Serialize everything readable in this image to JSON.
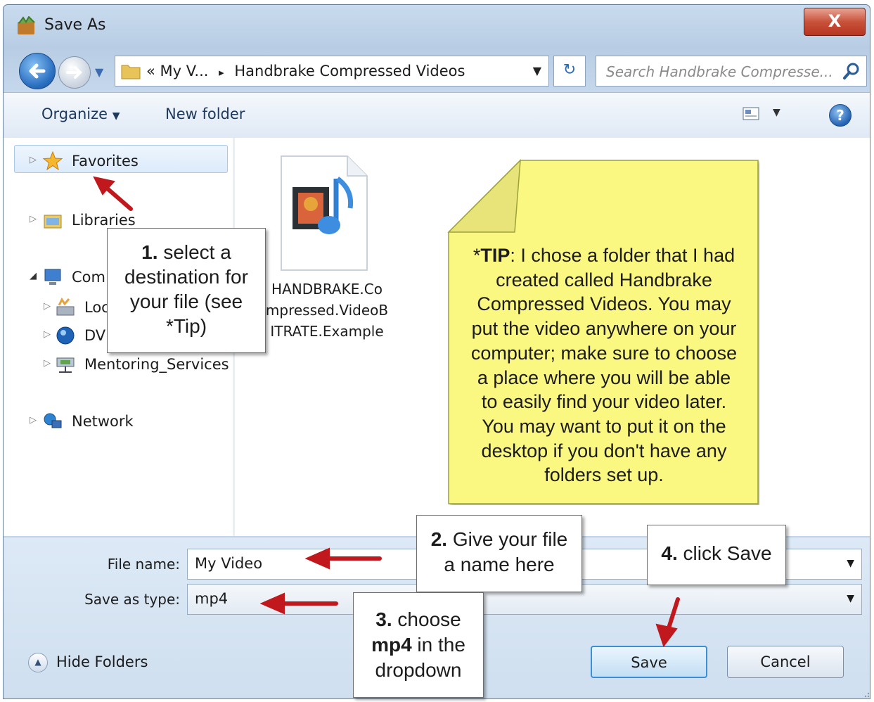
{
  "window": {
    "title": "Save As",
    "close_label": "X"
  },
  "nav": {
    "address_prefix": "«",
    "address_parts": [
      "My V...",
      "Handbrake Compressed Videos"
    ],
    "address_separator": "▸",
    "search_placeholder": "Search Handbrake Compresse..."
  },
  "toolbar": {
    "organize": "Organize",
    "new_folder": "New folder",
    "help": "?"
  },
  "sidebar": {
    "items": [
      {
        "label": "Favorites",
        "icon": "star-icon"
      },
      {
        "label": "Libraries",
        "icon": "libraries-icon"
      },
      {
        "label": "Com",
        "icon": "computer-icon"
      },
      {
        "label": "Loc",
        "icon": "local-disk-icon"
      },
      {
        "label": "DV",
        "icon": "dvd-drive-icon"
      },
      {
        "label": "Mentoring_Services",
        "icon": "network-drive-icon"
      },
      {
        "label": "Network",
        "icon": "network-icon"
      }
    ]
  },
  "file": {
    "name_lines": [
      "HANDBRAKE.Co",
      "mpressed.VideoB",
      "ITRATE.Example"
    ],
    "icon": "video-file-icon"
  },
  "form": {
    "file_name_label": "File name:",
    "file_name_value": "My Video",
    "save_type_label": "Save as type:",
    "save_type_value": "mp4"
  },
  "footer": {
    "hide_folders": "Hide Folders",
    "save": "Save",
    "cancel": "Cancel"
  },
  "callouts": {
    "c1": {
      "num": "1.",
      "line1": "select a",
      "line2": "destination for",
      "line3": "your file (see",
      "line4": "*Tip)"
    },
    "c2": {
      "num": "2.",
      "line1": "Give your file",
      "line2": "a name here"
    },
    "c3": {
      "num": "3.",
      "line1a": "choose",
      "bold": "mp4",
      "line2b": "in the",
      "line3": "dropdown"
    },
    "c4": {
      "num": "4.",
      "text": "click Save"
    }
  },
  "tip": {
    "label": "TIP",
    "star": "*",
    "lines": [
      ": I chose a folder that I had",
      "created called Handbrake",
      "Compressed Videos.  You may",
      "put the video anywhere on your",
      "computer; make sure to choose",
      "a place where you will be able",
      "to easily find your video later.",
      "You may want to put it on the",
      "desktop if you don't have any",
      "folders set up."
    ]
  },
  "colors": {
    "note_yellow": "#fbf882",
    "arrow_red": "#c0181c",
    "accent_blue": "#2a6ab8"
  }
}
